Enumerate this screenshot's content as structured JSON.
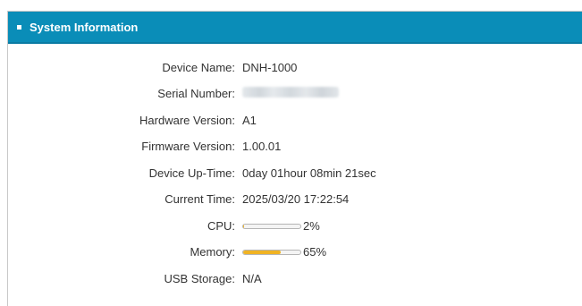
{
  "panel": {
    "title": "System Information"
  },
  "info": {
    "device_name": {
      "label": "Device Name:",
      "value": "DNH-1000"
    },
    "serial_number": {
      "label": "Serial Number:",
      "value": ""
    },
    "hardware_version": {
      "label": "Hardware Version:",
      "value": "A1"
    },
    "firmware_version": {
      "label": "Firmware Version:",
      "value": "1.00.01"
    },
    "uptime": {
      "label": "Device Up-Time:",
      "value": "0day 01hour 08min 21sec"
    },
    "current_time": {
      "label": "Current Time:",
      "value": "2025/03/20 17:22:54"
    },
    "cpu": {
      "label": "CPU:",
      "value_text": "2%",
      "percent": 2
    },
    "memory": {
      "label": "Memory:",
      "value_text": "65%",
      "percent": 65
    },
    "usb_storage": {
      "label": "USB Storage:",
      "value": "N/A"
    }
  },
  "colors": {
    "header_bg": "#0a8db8",
    "memory_bar": "#f0b323",
    "cpu_bar": "#f0b323"
  }
}
